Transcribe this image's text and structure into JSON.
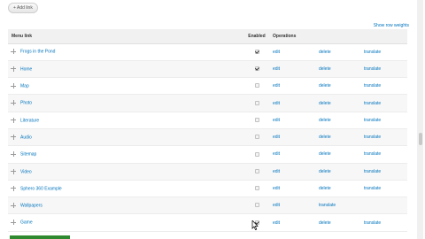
{
  "toolbar": {
    "add_link_label": "+ Add link"
  },
  "show_weights_label": "Show row weights",
  "table": {
    "headers": {
      "menu_link": "Menu link",
      "enabled": "Enabled",
      "operations": "Operations"
    },
    "rows": [
      {
        "label": "Frogs in the Pond",
        "enabled": true,
        "ops": [
          "edit",
          "delete",
          "translate"
        ]
      },
      {
        "label": "Home",
        "enabled": true,
        "ops": [
          "edit",
          "delete",
          "translate"
        ]
      },
      {
        "label": "Map",
        "enabled": false,
        "ops": [
          "edit",
          "delete",
          "translate"
        ]
      },
      {
        "label": "Photo",
        "enabled": false,
        "ops": [
          "edit",
          "delete",
          "translate"
        ]
      },
      {
        "label": "Literature",
        "enabled": false,
        "ops": [
          "edit",
          "delete",
          "translate"
        ]
      },
      {
        "label": "Audio",
        "enabled": false,
        "ops": [
          "edit",
          "delete",
          "translate"
        ]
      },
      {
        "label": "Sitemap",
        "enabled": false,
        "ops": [
          "edit",
          "delete",
          "translate"
        ]
      },
      {
        "label": "Video",
        "enabled": false,
        "ops": [
          "edit",
          "delete",
          "translate"
        ]
      },
      {
        "label": "Sphero 360 Example",
        "enabled": false,
        "ops": [
          "edit",
          "delete",
          "translate"
        ]
      },
      {
        "label": "Wallpapers",
        "enabled": false,
        "ops": [
          "edit",
          "translate"
        ]
      },
      {
        "label": "Game",
        "enabled": true,
        "ops": [
          "edit",
          "delete",
          "translate"
        ]
      }
    ]
  },
  "colors": {
    "link": "#0074bd",
    "save_button": "#2f8a2f"
  },
  "icons": {
    "drag_handle": "drag-handle-icon",
    "checkbox": "checkbox"
  }
}
